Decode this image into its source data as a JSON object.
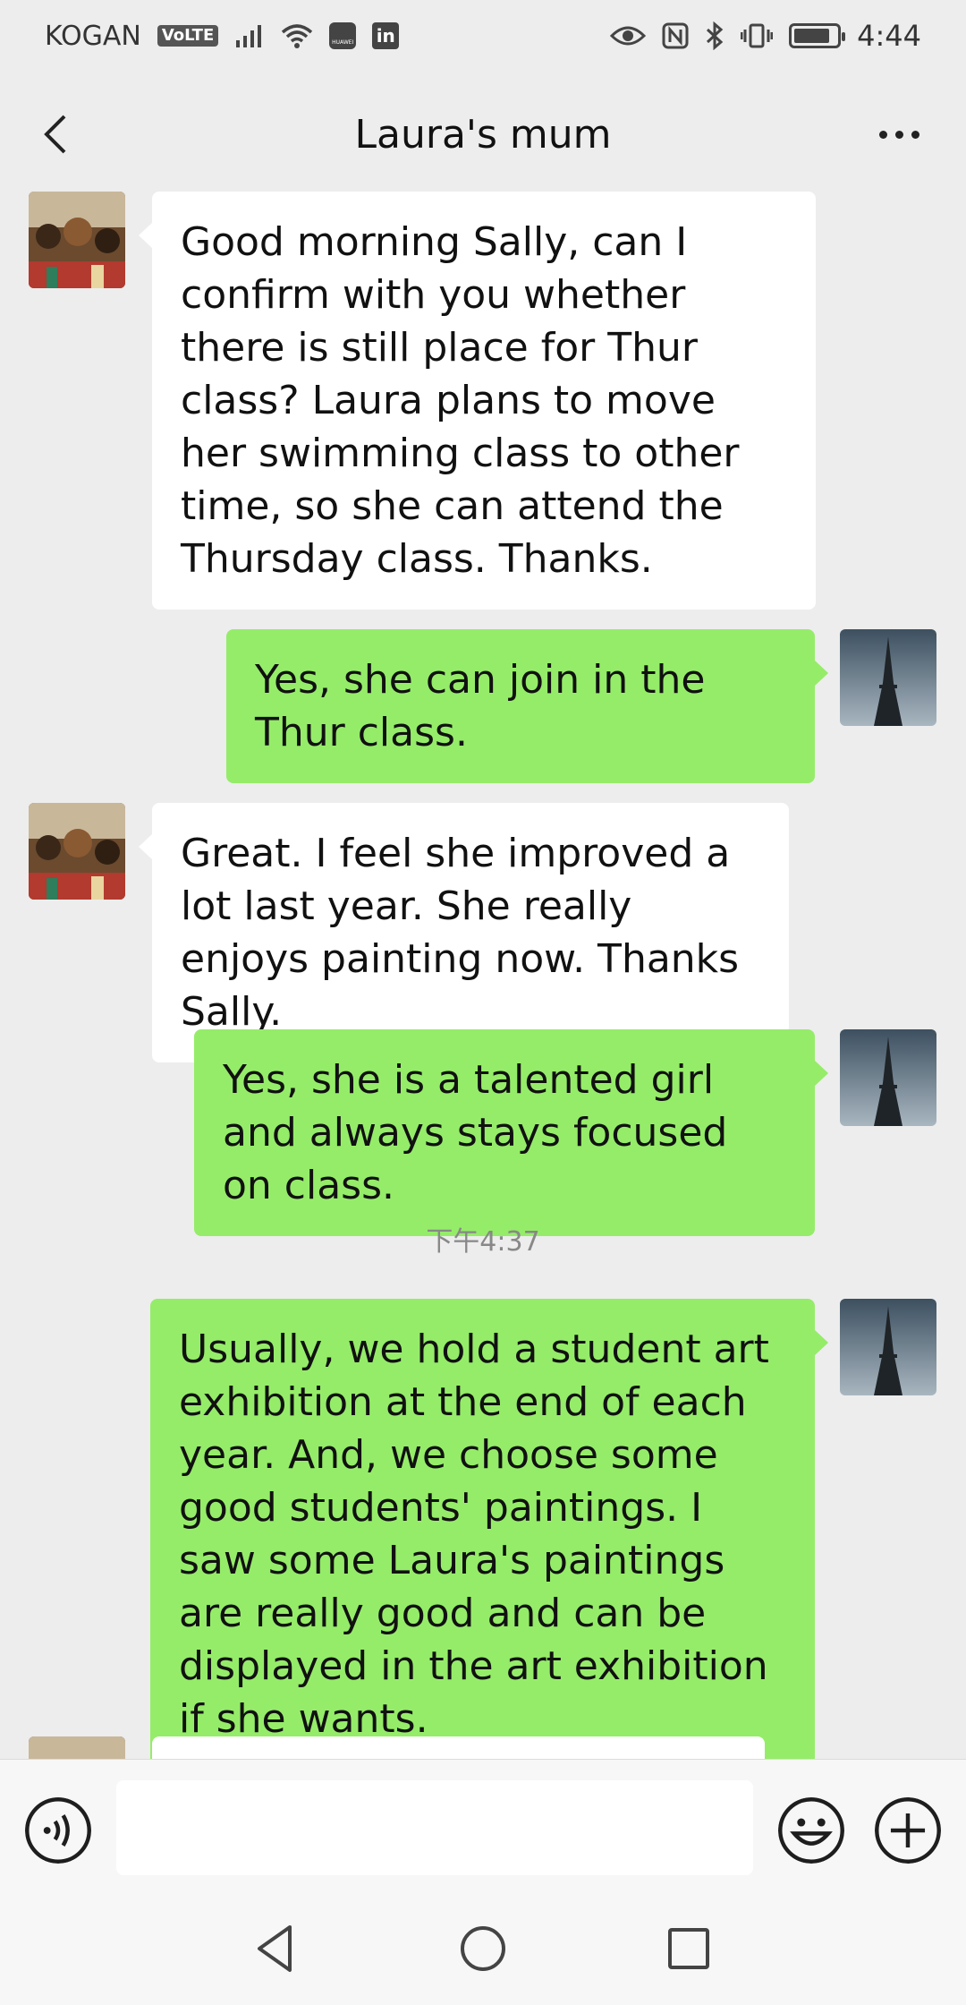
{
  "status_bar": {
    "carrier": "KOGAN",
    "volte_badge": "VoLTE",
    "mini_label": "HUAWEI",
    "linkedin_label": "in",
    "time": "4:44",
    "battery_level": 0.85
  },
  "header": {
    "title": "Laura's mum"
  },
  "messages": [
    {
      "direction": "incoming",
      "text": "Good morning Sally, can I confirm with you whether there is still place for Thur class? Laura plans to move her swimming class to other time, so she can attend the Thursday class. Thanks."
    },
    {
      "direction": "outgoing",
      "text": "Yes, she can join in the Thur class."
    },
    {
      "direction": "incoming",
      "text": "Great. I feel she improved a lot last year. She really enjoys painting now. Thanks Sally."
    },
    {
      "direction": "outgoing",
      "text": "Yes, she is a talented girl and always stays focused on class."
    },
    {
      "direction": "outgoing",
      "text": "Usually, we hold a student art exhibition at the end of each year. And, we choose some good students' paintings. I saw some Laura's paintings are really good and can be displayed in the art exhibition if she wants."
    },
    {
      "direction": "incoming",
      "text": ""
    }
  ],
  "timestamp": "下午4:37",
  "input_bar": {
    "input_value": "",
    "voice_icon": "voice-icon",
    "emoji_icon": "emoji-icon",
    "plus_icon": "plus-icon"
  },
  "colors": {
    "chat_background": "#ededed",
    "outgoing_bubble": "#95ec69",
    "incoming_bubble": "#ffffff"
  }
}
